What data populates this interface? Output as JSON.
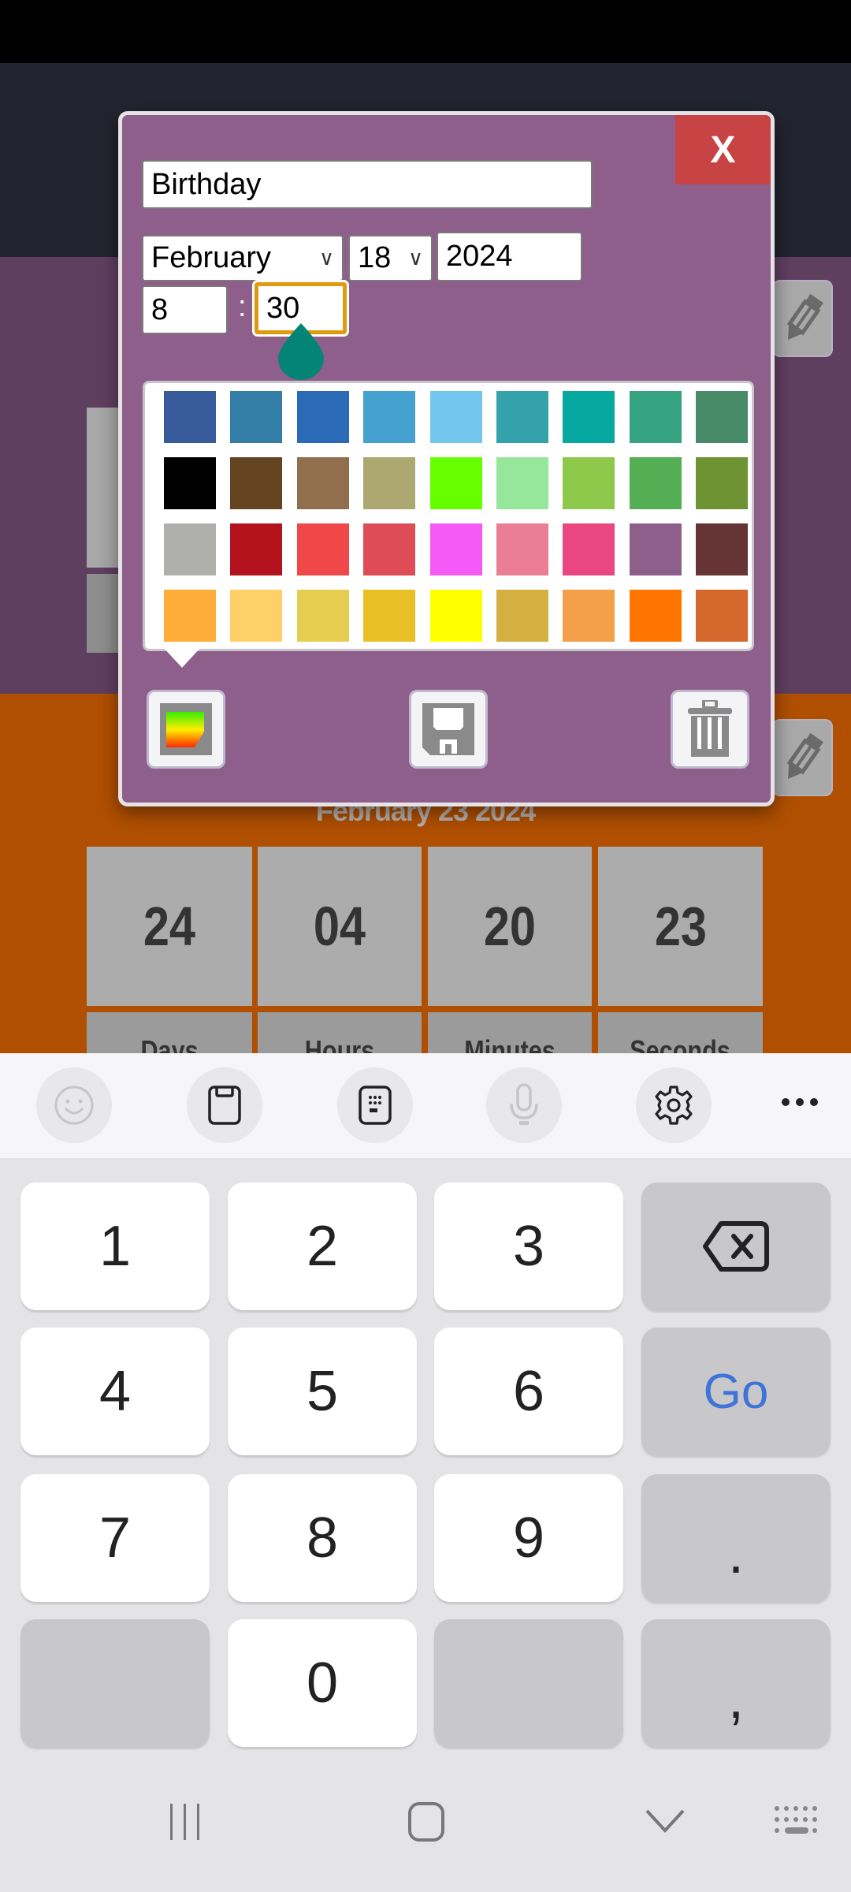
{
  "background": {
    "event_date": "February 23 2024",
    "countdown": [
      {
        "value": "24",
        "label": "Days"
      },
      {
        "value": "04",
        "label": "Hours"
      },
      {
        "value": "20",
        "label": "Minutes"
      },
      {
        "value": "23",
        "label": "Seconds"
      }
    ],
    "section_colors": {
      "purple": "#5f3f5f",
      "orange": "#b04f00"
    }
  },
  "dialog": {
    "close_label": "X",
    "title_value": "Birthday",
    "month_value": "February",
    "day_value": "18",
    "year_value": "2024",
    "hour_value": "8",
    "time_separator": ":",
    "minute_value": "30",
    "background_color": "#8e5f8b",
    "palette": [
      [
        "#365a9a",
        "#327ea6",
        "#2a6ab6",
        "#45a2d0",
        "#72c6ee",
        "#33a2aa",
        "#07a8a0",
        "#35a37f",
        "#478a67"
      ],
      [
        "#000000",
        "#654422",
        "#906e4e",
        "#ada870",
        "#66ff00",
        "#96e69c",
        "#8dc84a",
        "#53ae54",
        "#6d9333"
      ],
      [
        "#afafab",
        "#b4121c",
        "#f04848",
        "#de4c58",
        "#f65af6",
        "#ea7e94",
        "#ea4680",
        "#8e5f8b",
        "#663434"
      ],
      [
        "#fdad38",
        "#fed068",
        "#e6cc50",
        "#e8c026",
        "#ffff00",
        "#d4b040",
        "#f49f4a",
        "#ff7500",
        "#d4682c"
      ]
    ],
    "buttons": {
      "color_picker": "color-gradient-icon",
      "save": "floppy-disk-icon",
      "delete": "trash-icon"
    }
  },
  "keyboard": {
    "toolbar": [
      "emoji-icon",
      "clipboard-icon",
      "numeric-keypad-icon",
      "microphone-icon",
      "settings-icon",
      "more-icon"
    ],
    "keys": [
      [
        "1",
        "2",
        "3",
        "⌫"
      ],
      [
        "4",
        "5",
        "6",
        "Go"
      ],
      [
        "7",
        "8",
        "9",
        "."
      ],
      [
        "",
        "0",
        "",
        ","
      ]
    ]
  },
  "nav_bar": [
    "recent-apps-icon",
    "home-icon",
    "back-icon",
    "keyboard-switch-icon"
  ]
}
